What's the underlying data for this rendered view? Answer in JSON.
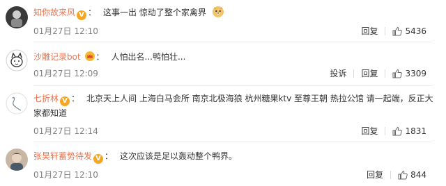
{
  "comments": [
    {
      "user": "知你故来风",
      "badge": "V",
      "text": "这事一出 惊动了整个家禽界",
      "emoji": "doge-emoji",
      "time": "01月27日 12:10",
      "report": "",
      "reply": "回复",
      "likes": "5436"
    },
    {
      "user": "沙雕记录bot",
      "badge": "crown",
      "text": "人怕出名...鸭怕壮...",
      "time": "01月27日 12:09",
      "report": "投诉",
      "reply": "回复",
      "likes": "3309"
    },
    {
      "user": "七折林",
      "badge": "V",
      "text": "北京天上人间 上海白马会所 南京北极海狼 杭州糖果ktv 至尊王朝 热拉公馆 请一起端，反正大家都知道",
      "time": "01月27日 12:14",
      "report": "",
      "reply": "回复",
      "likes": "1831"
    },
    {
      "user": "张昊轩蓄势待发",
      "badge": "V",
      "text": "这次应该是足以轰动整个鸭界。",
      "time": "01月27日 12:10",
      "report": "",
      "reply": "回复",
      "likes": "844"
    }
  ],
  "colors": {
    "username": "#eb7350",
    "meta": "#808080",
    "badge": "#f5a623"
  }
}
